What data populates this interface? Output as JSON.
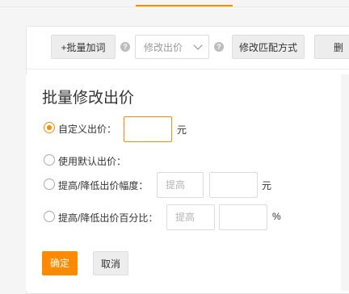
{
  "toolbar": {
    "batch_add_label": "+批量加词",
    "price_select_placeholder": "修改出价",
    "help_glyph": "?",
    "match_button_label": "修改匹配方式",
    "partial_button_label": "删"
  },
  "dialog": {
    "title": "批量修改出价",
    "options": [
      {
        "label": "自定义出价：",
        "selected": true,
        "unit": "元"
      },
      {
        "label": "使用默认出价：",
        "selected": false
      },
      {
        "label": "提高/降低出价幅度：",
        "selected": false,
        "select_placeholder": "提高",
        "unit": "元"
      },
      {
        "label": "提高/降低出价百分比：",
        "selected": false,
        "select_placeholder": "提高",
        "unit": "%"
      }
    ],
    "confirm_label": "确定",
    "cancel_label": "取消"
  },
  "colors": {
    "accent": "#ff8a00",
    "button_bg": "#ededed"
  }
}
